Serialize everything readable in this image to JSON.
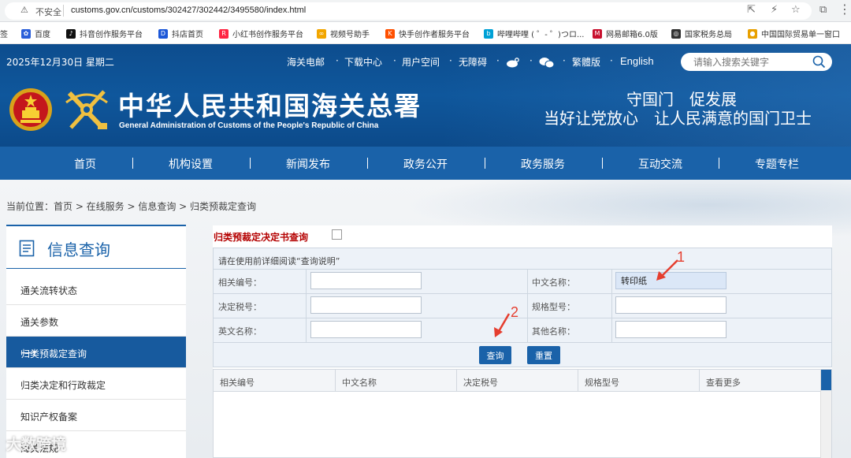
{
  "browser": {
    "security_label": "不安全",
    "url": "customs.gov.cn/customs/302427/302442/3495580/index.html",
    "bookmarks": [
      {
        "label": "签",
        "color": "#888888"
      },
      {
        "label": "百度",
        "color": "#2b5fd9"
      },
      {
        "label": "抖音创作服务平台",
        "color": "#111111"
      },
      {
        "label": "抖店首页",
        "color": "#1d58d8"
      },
      {
        "label": "小红书创作服务平台",
        "color": "#ff2442"
      },
      {
        "label": "视频号助手",
        "color": "#f2a600"
      },
      {
        "label": "快手创作者服务平台",
        "color": "#ff5000"
      },
      {
        "label": "哔哩哔哩 ( ゜- ゜)つロ...",
        "color": "#00a1d6"
      },
      {
        "label": "网易邮箱6.0版",
        "color": "#c8102e"
      },
      {
        "label": "国家税务总局",
        "color": "#333333"
      },
      {
        "label": "中国国际贸易单一窗口",
        "color": "#e8a000"
      }
    ]
  },
  "header": {
    "date": "2025年12月30日 星期二",
    "top_links": [
      "海关电邮",
      "下载中心",
      "用户空间",
      "无障碍",
      "繁體版",
      "English"
    ],
    "search_placeholder": "请输入搜索关键字",
    "title": "中华人民共和国海关总署",
    "subtitle": "General Administration of Customs of the People's Republic of China",
    "slogan_line1": "守国门　促发展",
    "slogan_line2": "当好让党放心　让人民满意的国门卫士"
  },
  "main_nav": [
    "首页",
    "机构设置",
    "新闻发布",
    "政务公开",
    "政务服务",
    "互动交流",
    "专题专栏"
  ],
  "breadcrumb": "当前位置：首页 > 在线服务 > 信息查询 > 归类预裁定查询",
  "sidebar": {
    "heading": "信息查询",
    "items": [
      {
        "label": "通关流转状态",
        "active": false
      },
      {
        "label": "通关参数",
        "active": false
      },
      {
        "label": "归类预裁定查询",
        "active": true
      },
      {
        "label": "归类决定和行政裁定",
        "active": false
      },
      {
        "label": "知识产权备案",
        "active": false
      },
      {
        "label": "海关法规",
        "active": false
      }
    ],
    "active_arrow": "⟶"
  },
  "form": {
    "title": "归类预裁定决定书查询",
    "note": "请在使用前详细阅读“查询说明”",
    "fields": {
      "ref_no_label": "相关编号：",
      "ref_no_value": "",
      "cn_name_label": "中文名称：",
      "cn_name_value": "转印纸",
      "tax_no_label": "决定税号：",
      "tax_no_value": "",
      "spec_label": "规格型号：",
      "spec_value": "",
      "en_name_label": "英文名称：",
      "en_name_value": "",
      "other_name_label": "其他名称：",
      "other_name_value": ""
    },
    "query_button": "查询",
    "reset_button": "重置",
    "annotation_1": "1",
    "annotation_2": "2"
  },
  "results": {
    "columns": [
      "相关编号",
      "中文名称",
      "决定税号",
      "规格型号",
      "查看更多"
    ]
  },
  "watermark": "大数跨境",
  "colors": {
    "brand_blue": "#0f579c",
    "nav_blue": "#1a62a9",
    "title_red": "#b40000",
    "annotation_red": "#e53e2f"
  }
}
